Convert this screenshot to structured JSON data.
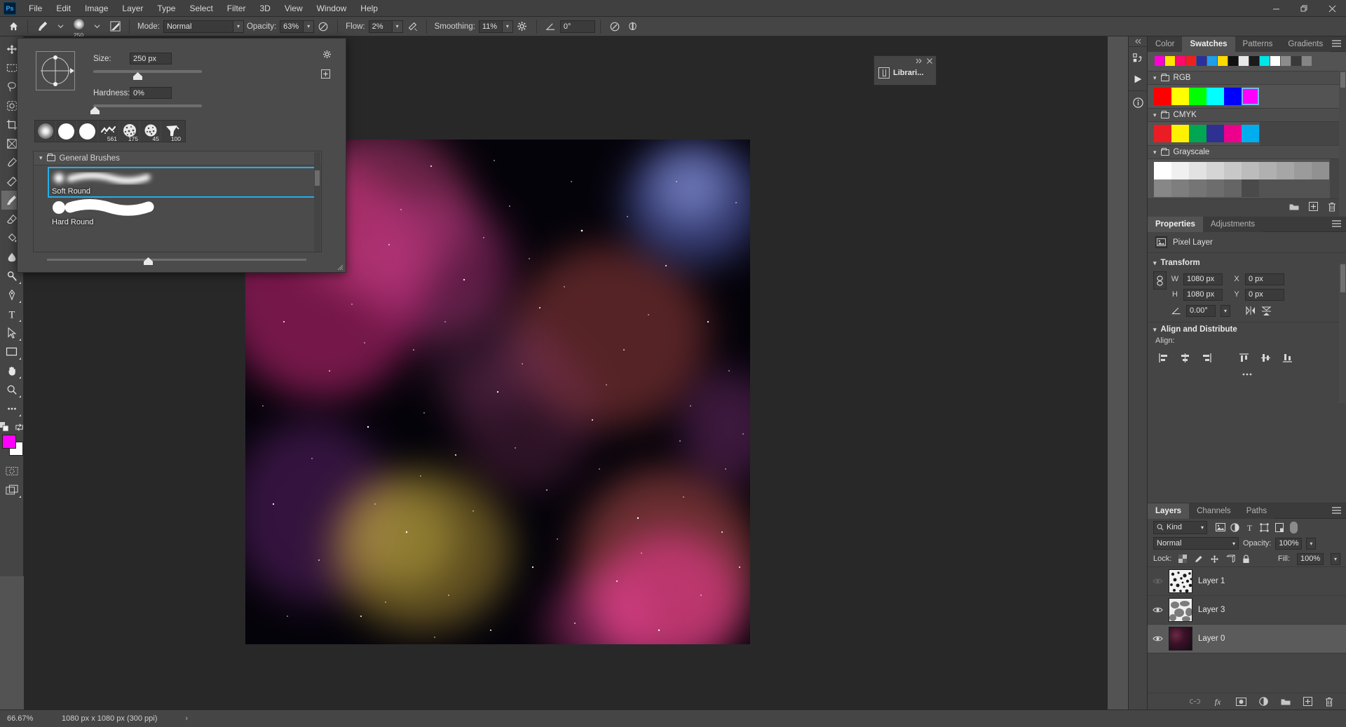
{
  "app": {
    "name": "Ps"
  },
  "menubar": {
    "items": [
      "File",
      "Edit",
      "Image",
      "Layer",
      "Type",
      "Select",
      "Filter",
      "3D",
      "View",
      "Window",
      "Help"
    ],
    "window_controls": [
      "minimize",
      "maximize",
      "close"
    ]
  },
  "options_bar": {
    "home_icon": "home-icon",
    "tool_icon": "brush-tool-icon",
    "brush_size_number": "250",
    "toggle_panel_icon": "brush-settings-icon",
    "mode_label": "Mode:",
    "mode_value": "Normal",
    "opacity_label": "Opacity:",
    "opacity_value": "63%",
    "pressure_opacity_icon": "pressure-opacity-icon",
    "flow_label": "Flow:",
    "flow_value": "2%",
    "airbrush_icon": "airbrush-icon",
    "smoothing_label": "Smoothing:",
    "smoothing_value": "11%",
    "smoothing_options_icon": "gear-icon",
    "angle_icon": "angle-icon",
    "angle_value": "0°",
    "pressure_size_icon": "pressure-size-icon",
    "symmetry_icon": "symmetry-butterfly-icon"
  },
  "brush_picker": {
    "size_label": "Size:",
    "size_value": "250 px",
    "hardness_label": "Hardness:",
    "hardness_value": "0%",
    "gear_icon": "gear-icon",
    "new_preset_icon": "new-preset-icon",
    "preset_strip": [
      {
        "name": "soft-round-preset",
        "label": ""
      },
      {
        "name": "hard-round-preset",
        "label": ""
      },
      {
        "name": "hard-round-pressure-preset",
        "label": ""
      },
      {
        "name": "flat-fan-preset",
        "label": "561"
      },
      {
        "name": "chalk-preset",
        "label": "175"
      },
      {
        "name": "chalk-small-preset",
        "label": "45"
      },
      {
        "name": "kyle-brush-preset",
        "label": "100"
      }
    ],
    "folder_label": "General Brushes",
    "brushes": [
      {
        "name": "Soft Round",
        "selected": true
      },
      {
        "name": "Hard Round",
        "selected": false
      }
    ]
  },
  "libraries_panel": {
    "title": "Librari...",
    "expand_icon": "double-chevron-right-icon",
    "close_icon": "close-icon",
    "book_icon": "libraries-icon"
  },
  "toolbar": {
    "tools": [
      "move-tool",
      "rectangular-marquee-tool",
      "lasso-tool",
      "object-selection-tool",
      "crop-tool",
      "frame-tool",
      "eyedropper-tool",
      "spot-healing-brush-tool",
      "brush-tool",
      "clone-stamp-tool",
      "history-brush-tool",
      "eraser-tool",
      "gradient-tool",
      "blur-tool",
      "dodge-tool",
      "pen-tool",
      "horizontal-type-tool",
      "path-selection-tool",
      "rectangle-tool",
      "hand-tool",
      "zoom-tool",
      "edit-toolbar-tool"
    ],
    "foreground_color": "#ff00ff",
    "background_color": "#ffffff",
    "swap_colors_icon": "swap-colors-icon",
    "default_colors_icon": "default-colors-icon",
    "quick_mask_icon": "quick-mask-icon",
    "screen_mode_icon": "screen-mode-icon"
  },
  "right_rail": {
    "collapse_icon": "double-chevron-left-icon",
    "buttons": [
      "history-icon",
      "play-actions-icon",
      "info-icon"
    ]
  },
  "swatches_panel": {
    "tabs": [
      "Color",
      "Swatches",
      "Patterns",
      "Gradients"
    ],
    "active_tab": "Swatches",
    "menu_icon": "panel-menu-icon",
    "recent": [
      "#ff00d4",
      "#ffe400",
      "#ff0a6e",
      "#f01f1f",
      "#2a2f9e",
      "#1f9fe8",
      "#ffd900",
      "#111111",
      "#e8e8e8",
      "#1a1a1a",
      "#00e5e5",
      "#ffffff",
      "#8c8c8c",
      "#3a3a3a",
      "#858585"
    ],
    "groups": [
      {
        "name": "RGB",
        "colors": [
          "#ff0000",
          "#ffff00",
          "#00ff00",
          "#00ffff",
          "#0000ff",
          "#ff00ff"
        ],
        "selected_index": 5
      },
      {
        "name": "CMYK",
        "colors": [
          "#ec1c24",
          "#fff200",
          "#00a651",
          "#2e3192",
          "#ec008c",
          "#00aeef"
        ],
        "selected_index": -1
      },
      {
        "name": "Grayscale",
        "colors": [
          "#ffffff",
          "#f0f0f0",
          "#e2e2e2",
          "#d5d5d5",
          "#c8c8c8",
          "#bcbcbc",
          "#b0b0b0",
          "#a6a6a6",
          "#9b9b9b",
          "#919191",
          "#878787",
          "#7e7e7e",
          "#757575",
          "#6d6d6d",
          "#656565",
          "#4a4a4a"
        ],
        "selected_index": -1
      }
    ],
    "footer_buttons": [
      "new-group-icon",
      "new-swatch-icon",
      "delete-swatch-icon"
    ]
  },
  "properties_panel": {
    "tabs": [
      "Properties",
      "Adjustments"
    ],
    "active_tab": "Properties",
    "menu_icon": "panel-menu-icon",
    "layer_type_icon": "pixel-layer-icon",
    "layer_type": "Pixel Layer",
    "transform": {
      "title": "Transform",
      "link_icon": "link-dimensions-icon",
      "w_label": "W",
      "w_value": "1080 px",
      "h_label": "H",
      "h_value": "1080 px",
      "x_label": "X",
      "x_value": "0 px",
      "y_label": "Y",
      "y_value": "0 px",
      "angle_icon": "rotate-angle-icon",
      "angle_value": "0.00°",
      "flip_horizontal_icon": "flip-horizontal-icon",
      "flip_vertical_icon": "flip-vertical-icon"
    },
    "align": {
      "title": "Align and Distribute",
      "label": "Align:",
      "buttons": [
        "align-left-edges-icon",
        "align-horizontal-centers-icon",
        "align-right-edges-icon",
        "align-top-edges-icon",
        "align-vertical-centers-icon",
        "align-bottom-edges-icon"
      ],
      "more_icon": "more-options-icon"
    }
  },
  "layers_panel": {
    "tabs": [
      "Layers",
      "Channels",
      "Paths"
    ],
    "active_tab": "Layers",
    "menu_icon": "panel-menu-icon",
    "filter": {
      "search_icon": "search-icon",
      "kind_label": "Kind",
      "chevron_icon": "chevron-down-icon",
      "type_filters": [
        "filter-pixel-icon",
        "filter-adjustment-icon",
        "filter-type-icon",
        "filter-shape-icon",
        "filter-smart-object-icon"
      ],
      "toggle_icon": "filter-toggle-switch"
    },
    "blend_mode": "Normal",
    "opacity_label": "Opacity:",
    "opacity_value": "100%",
    "lock_label": "Lock:",
    "lock_icons": [
      "lock-transparent-pixels-icon",
      "lock-image-pixels-icon",
      "lock-position-icon",
      "lock-artboard-icon",
      "lock-all-icon"
    ],
    "fill_label": "Fill:",
    "fill_value": "100%",
    "layers": [
      {
        "name": "Layer 1",
        "visible": false,
        "selected": false,
        "thumb": "noise"
      },
      {
        "name": "Layer 3",
        "visible": true,
        "selected": false,
        "thumb": "clouds"
      },
      {
        "name": "Layer 0",
        "visible": true,
        "selected": true,
        "thumb": "nebula"
      }
    ],
    "footer_buttons": [
      "link-layers-icon",
      "layer-styles-icon",
      "layer-mask-icon",
      "new-fill-adjustment-icon",
      "new-group-icon",
      "new-layer-icon",
      "delete-layer-icon"
    ]
  },
  "status_bar": {
    "zoom": "66.67%",
    "doc_size": "1080 px x 1080 px (300 ppi)",
    "expand_icon": "chevron-right-icon"
  }
}
